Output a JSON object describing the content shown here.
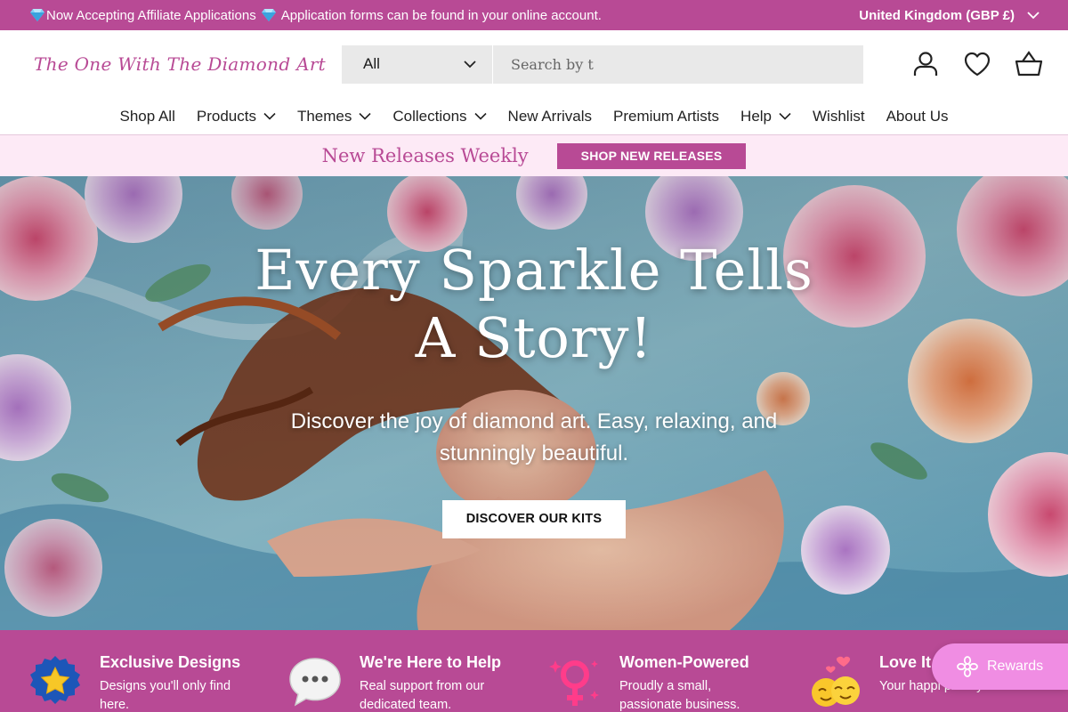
{
  "announcement": {
    "text_part1": "Now Accepting Affiliate Applications",
    "text_part2": "Application forms can be found in your online account.",
    "region": "United Kingdom (GBP £)"
  },
  "header": {
    "logo_text": "The One With The Diamond Art",
    "search_category": "All",
    "search_placeholder": "Search by t"
  },
  "nav": {
    "items": [
      {
        "label": "Shop All"
      },
      {
        "label": "Products"
      },
      {
        "label": "Themes"
      },
      {
        "label": "Collections"
      },
      {
        "label": "New Arrivals"
      },
      {
        "label": "Premium Artists"
      },
      {
        "label": "Help"
      },
      {
        "label": "Wishlist"
      },
      {
        "label": "About Us"
      }
    ]
  },
  "promo": {
    "text": "New Releases Weekly",
    "button": "SHOP NEW RELEASES"
  },
  "hero": {
    "title_line1": "Every Sparkle Tells",
    "title_line2": "A Story!",
    "subtitle": "Discover the joy of diamond art. Easy, relaxing, and stunningly beautiful.",
    "button": "DISCOVER OUR KITS"
  },
  "features": [
    {
      "title": "Exclusive Designs",
      "desc": "Designs you'll only find here.",
      "icon": "star-badge-icon"
    },
    {
      "title": "We're Here to Help",
      "desc": "Real support from our dedicated team.",
      "icon": "speech-bubble-icon"
    },
    {
      "title": "Women-Powered",
      "desc": "Proudly a small, passionate business.",
      "icon": "female-sign-icon"
    },
    {
      "title": "Love It,",
      "desc": "Your happi priority.",
      "icon": "hugging-face-icon"
    }
  ],
  "rewards": {
    "label": "Rewards"
  },
  "colors": {
    "brand": "#b84a95",
    "promo_bg": "#fdeaf6",
    "rewards": "#f08de3"
  }
}
